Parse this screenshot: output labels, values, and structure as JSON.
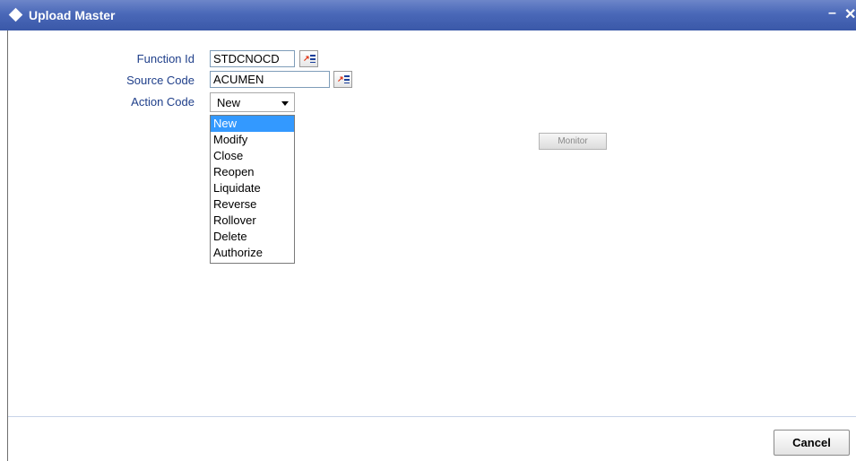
{
  "window": {
    "title": "Upload Master",
    "minimize_glyph": "–",
    "close_glyph": "✕"
  },
  "form": {
    "function_id": {
      "label": "Function Id",
      "value": "STDCNOCD"
    },
    "source_code": {
      "label": "Source Code",
      "value": "ACUMEN"
    },
    "action_code": {
      "label": "Action Code",
      "selected": "New",
      "options": [
        "New",
        "Modify",
        "Close",
        "Reopen",
        "Liquidate",
        "Reverse",
        "Rollover",
        "Delete",
        "Authorize"
      ]
    }
  },
  "buttons": {
    "monitor": "Monitor",
    "cancel": "Cancel"
  },
  "icons": {
    "title": "diamond-icon",
    "lov": "list-of-values-icon",
    "caret": "chevron-down-icon"
  },
  "colors": {
    "titlebar": "#4a68b8",
    "label": "#1f3f8a",
    "selected_option": "#3399ff"
  }
}
